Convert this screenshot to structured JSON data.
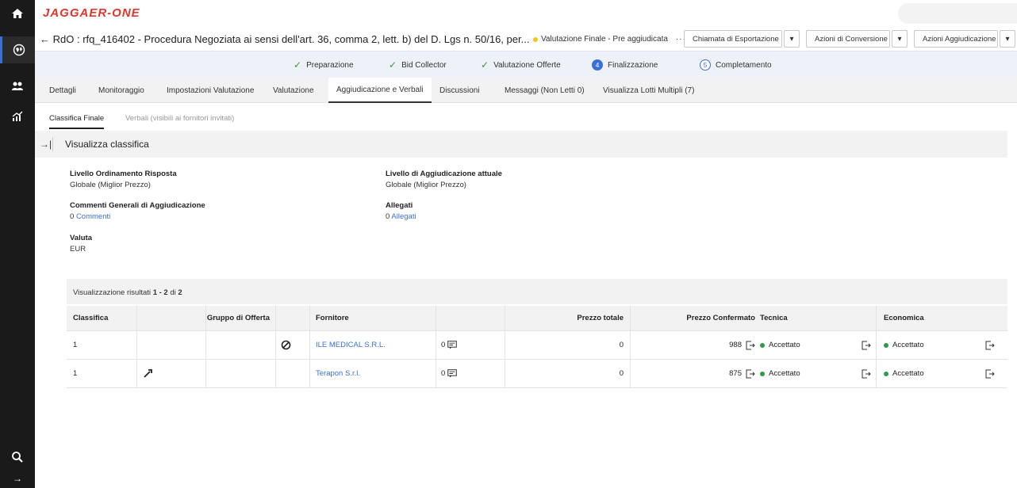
{
  "app": {
    "logo": "JAGGAER-ONE"
  },
  "rail": {
    "icons": [
      "home-icon",
      "globe-icon",
      "users-icon",
      "chart-icon",
      "search-icon",
      "arrow-right-icon"
    ]
  },
  "header": {
    "back_arrow": "←",
    "title": "RdO : rfq_416402 - Procedura Negoziata ai sensi dell'art. 36, comma 2, lett. b) del D. Lgs n. 50/16, per...",
    "status": "Valutazione Finale - Pre aggiudicata",
    "more": "···",
    "buttons": {
      "export": "Chiamata di Esportazione",
      "conversion": "Azioni di Conversione",
      "award": "Azioni Aggiudicazione"
    },
    "caret": "▾",
    "status_color": "#f5c518"
  },
  "steps": [
    {
      "label": "Preparazione",
      "state": "done"
    },
    {
      "label": "Bid Collector",
      "state": "done"
    },
    {
      "label": "Valutazione Offerte",
      "state": "done"
    },
    {
      "label": "Finalizzazione",
      "state": "current",
      "num": "4"
    },
    {
      "label": "Completamento",
      "state": "next",
      "num": "5"
    }
  ],
  "tabs": [
    "Dettagli",
    "Monitoraggio",
    "Impostazioni Valutazione",
    "Valutazione",
    "Aggiudicazione e Verbali",
    "Discussioni",
    "Messaggi (Non Letti 0)",
    "Visualizza Lotti Multipli (7)"
  ],
  "subtabs": [
    "Classifica Finale",
    "Verbali (visibili ai fornitori invitati)"
  ],
  "section": {
    "collapse_glyph": "→|",
    "title": "Visualizza classifica"
  },
  "info": {
    "ordering_label": "Livello Ordinamento Risposta",
    "ordering_value": "Globale (Miglior Prezzo)",
    "award_level_label": "Livello di Aggiudicazione attuale",
    "award_level_value": "Globale (Miglior Prezzo)",
    "comments_label": "Commenti Generali di Aggiudicazione",
    "comments_count": "0",
    "comments_link": "Commenti",
    "attachments_label": "Allegati",
    "attachments_count": "0",
    "attachments_link": "Allegati",
    "currency_label": "Valuta",
    "currency_value": "EUR"
  },
  "results": {
    "prefix": "Visualizzazione risultati ",
    "range": "1 - 2",
    "of": " di ",
    "total": "2"
  },
  "table": {
    "headers": {
      "rank": "Classifica",
      "group": "Gruppo di Offerta",
      "supplier": "Fornitore",
      "total": "Prezzo totale",
      "confirmed": "Prezzo Confermato",
      "tech": "Tecnica",
      "econ": "Economica"
    },
    "rows": [
      {
        "rank": "1",
        "action_icon": "blocked-icon",
        "supplier": "ILE MEDICAL S.R.L.",
        "comments": "0",
        "total": "0",
        "confirmed": "988",
        "tech": "Accettato",
        "econ": "Accettato"
      },
      {
        "rank": "1",
        "action_icon": "gavel-icon",
        "supplier": "Terapon S.r.l.",
        "comments": "0",
        "total": "0",
        "confirmed": "875",
        "tech": "Accettato",
        "econ": "Accettato"
      }
    ],
    "accepted_color": "#2e9b4a"
  }
}
